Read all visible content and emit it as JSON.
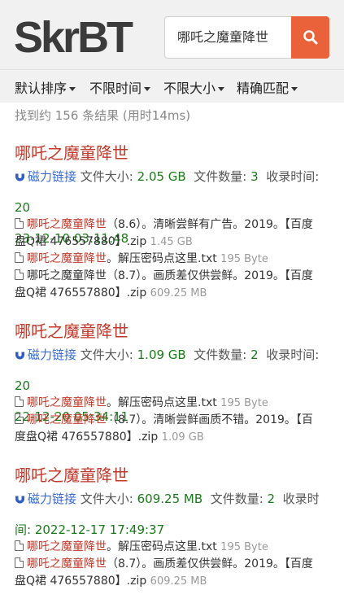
{
  "header": {
    "logo": "SkrBT",
    "search_value": "哪吒之魔童降世",
    "search_icon": "search-icon"
  },
  "filters": [
    {
      "label": "默认排序"
    },
    {
      "label": "不限时间"
    },
    {
      "label": "不限大小"
    },
    {
      "label": "精确匹配"
    }
  ],
  "summary": "找到约 156 条结果 (用时14ms)",
  "results": [
    {
      "title": "哪吒之魔童降世",
      "magnet_label": "磁力链接",
      "size_label": "文件大小:",
      "size": "2.05 GB",
      "count_label": "文件数量:",
      "count": "3",
      "date_label": "收录时间:",
      "date_a": "20",
      "date_b": "23-12-10 03:11:48",
      "files": [
        {
          "hl": "哪吒之魔童降世",
          "rest": "（8.6）。清晰尝鲜有广告。2019。【百度盘Q裙 476557880】.zip",
          "size": "1.45 GB"
        },
        {
          "hl": "哪吒之魔童降世",
          "rest": "。解压密码点这里.txt",
          "size": "195 Byte"
        },
        {
          "hl": "",
          "rest": "哪吒之魔童降世（8.7）。画质差仅供尝鲜。2019。【百度盘Q裙 476557880】.zip",
          "size": "609.25 MB"
        }
      ]
    },
    {
      "title": "哪吒之魔童降世",
      "magnet_label": "磁力链接",
      "size_label": "文件大小:",
      "size": "1.09 GB",
      "count_label": "文件数量:",
      "count": "2",
      "date_label": "收录时间:",
      "date_a": "20",
      "date_b": "22-12-20 05:34:11",
      "files": [
        {
          "hl": "哪吒之魔童降世",
          "rest": "。解压密码点这里.txt",
          "size": "195 Byte"
        },
        {
          "hl": "哪吒之魔童降世",
          "rest": "（8.7）。清晰尝鲜画质不错。2019。【百度盘Q裙 476557880】.zip",
          "size": "1.09 GB"
        }
      ]
    },
    {
      "title": "哪吒之魔童降世",
      "magnet_label": "磁力链接",
      "size_label": "文件大小:",
      "size": "609.25 MB",
      "count_label": "文件数量:",
      "count": "2",
      "date_label": "收录时",
      "date_a": "",
      "date_b": "间: 2022-12-17 17:49:37",
      "files": [
        {
          "hl": "哪吒之魔童降世",
          "rest": "。解压密码点这里.txt",
          "size": "195 Byte"
        },
        {
          "hl": "哪吒之魔童降世",
          "rest": "（8.7）。画质差仅供尝鲜。2019。【百度盘Q裙 476557880】.zip",
          "size": "609.25 MB"
        }
      ]
    }
  ]
}
